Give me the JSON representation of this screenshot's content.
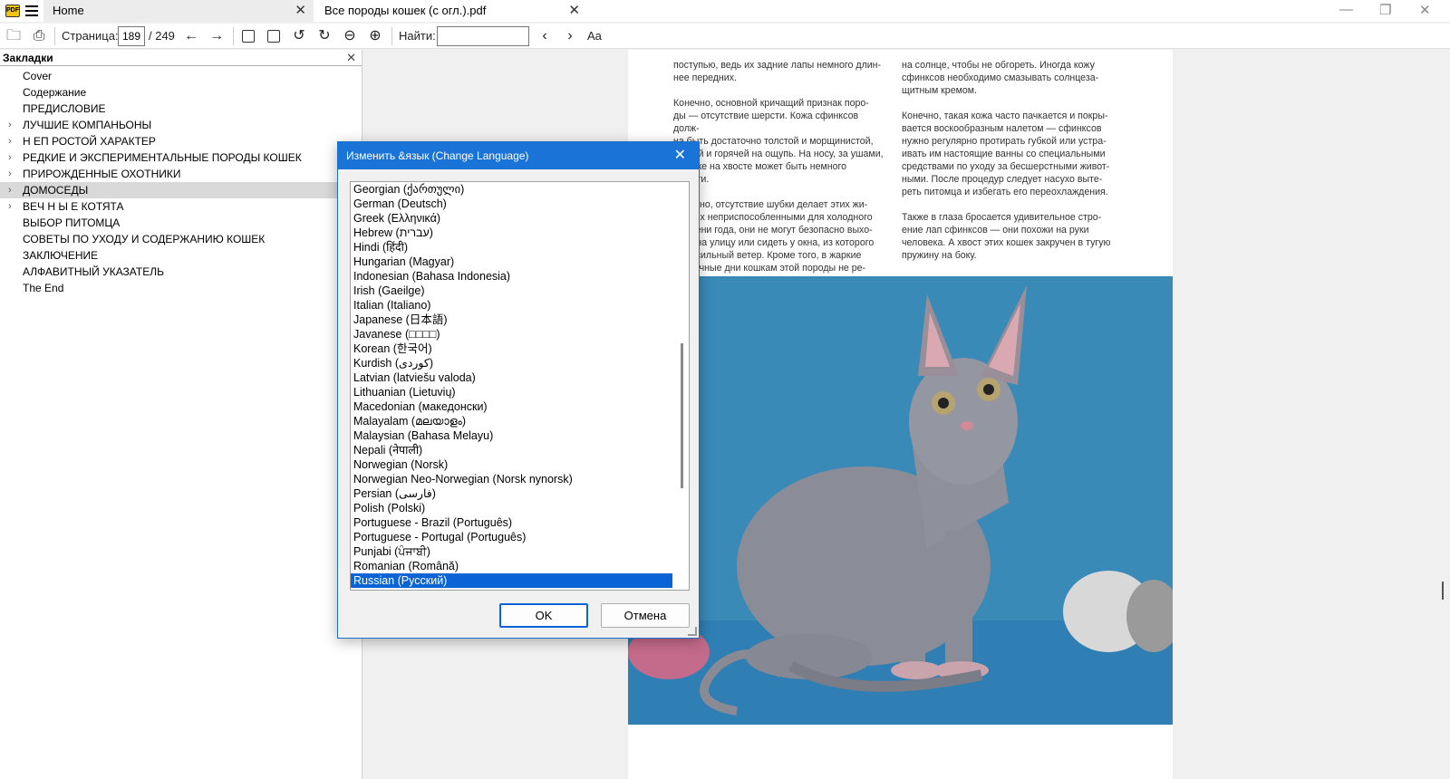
{
  "titlebar": {
    "app_icon": "pdf-app-icon",
    "tabs": [
      {
        "label": "Home"
      },
      {
        "label": "Все породы кошек (с огл.).pdf"
      }
    ]
  },
  "toolbar": {
    "page_label": "Страница:",
    "page_current": "189",
    "page_total": "/ 249",
    "find_label": "Найти:",
    "font_button": "Aa"
  },
  "bookmarks": {
    "title": "Закладки",
    "items": [
      {
        "label": "Cover",
        "expandable": false
      },
      {
        "label": "Содержание",
        "expandable": false
      },
      {
        "label": "ПРЕДИСЛОВИЕ",
        "expandable": false
      },
      {
        "label": "ЛУЧШИЕ КОМПАНЬОНЫ",
        "expandable": true
      },
      {
        "label": "Н ЕП РОСТОЙ ХАРАКТЕР",
        "expandable": true
      },
      {
        "label": "РЕДКИЕ И ЭКСПЕРИМЕНТАЛЬНЫЕ ПОРОДЫ КОШЕК",
        "expandable": true
      },
      {
        "label": "ПРИРОЖДЕННЫЕ ОХОТНИКИ",
        "expandable": true
      },
      {
        "label": "ДОМОСЕДЫ",
        "expandable": true,
        "selected": true
      },
      {
        "label": "ВЕЧ Н Ы Е КОТЯТА",
        "expandable": true
      },
      {
        "label": "ВЫБОР ПИТОМЦА",
        "expandable": false
      },
      {
        "label": "СОВЕТЫ ПО УХОДУ И СОДЕРЖАНИЮ КОШЕК",
        "expandable": false
      },
      {
        "label": "ЗАКЛЮЧЕНИЕ",
        "expandable": false
      },
      {
        "label": "АЛФАВИТНЫЙ УКАЗАТЕЛЬ",
        "expandable": false
      },
      {
        "label": "The End",
        "expandable": false
      }
    ]
  },
  "page": {
    "col1": "поступью, ведь их задние лапы немного длин-\nнее передних.\n\nКонечно, основной кричащий признак поро-\nды — отсутствие шерсти. Кожа сфинксов долж-\nна быть достаточно толстой и морщинистой,\nмягкой и горячей на ощупь. На носу, за ушами,\nа также на хвосте может быть немного шерсти.\n\nКонечно, отсутствие шубки делает этих жи-\nвотных неприспособленными для холодного\nвремени года, они не могут безопасно выхо-\nдить на улицу или сидеть у окна, из которого\nдует сильный ветер. Кроме того, в жаркие\nсолнечные дни кошкам этой породы не ре-\nкомендуется длительное время находиться",
    "col2": "на солнце, чтобы не обгореть. Иногда кожу\nсфинксов необходимо смазывать солнцеза-\nщитным кремом.\n\nКонечно, такая кожа часто пачкается и покры-\nвается воскообразным налетом — сфинксов\nнужно регулярно протирать губкой или устра-\nивать им настоящие ванны со специальными\nсредствами по уходу за бесшерстными живот-\nными. После процедур следует насухо выте-\nреть питомца и избегать его переохлаждения.\n\nТакже в глаза бросается удивительное стро-\nение лап сфинксов — они похожи на руки\nчеловека. А хвост этих кошек закручен в тугую\nпружину на боку."
  },
  "dialog": {
    "title": "Изменить &язык (Change Language)",
    "languages": [
      "Georgian (ქართული)",
      "German (Deutsch)",
      "Greek (Ελληνικά)",
      "Hebrew (עברית)",
      "Hindi (हिंदी)",
      "Hungarian (Magyar)",
      "Indonesian (Bahasa Indonesia)",
      "Irish (Gaeilge)",
      "Italian (Italiano)",
      "Japanese (日本語)",
      "Javanese (□□□□)",
      "Korean (한국어)",
      "Kurdish (كوردی)",
      "Latvian (latviešu valoda)",
      "Lithuanian (Lietuvių)",
      "Macedonian (македонски)",
      "Malayalam (മലയാളം)",
      "Malaysian (Bahasa Melayu)",
      "Nepali (नेपाली)",
      "Norwegian (Norsk)",
      "Norwegian Neo-Norwegian (Norsk nynorsk)",
      "Persian (فارسی)",
      "Polish (Polski)",
      "Portuguese - Brazil (Português)",
      "Portuguese - Portugal (Português)",
      "Punjabi (ਪੰਜਾਬੀ)",
      "Romanian (Română)",
      "Russian (Русский)"
    ],
    "selected_language": "Russian (Русский)",
    "ok_label": "OK",
    "cancel_label": "Отмена"
  },
  "colors": {
    "dialog_titlebar": "#1a73d6",
    "selection": "#0a64d6",
    "photo_background": "#3a8ab8"
  }
}
